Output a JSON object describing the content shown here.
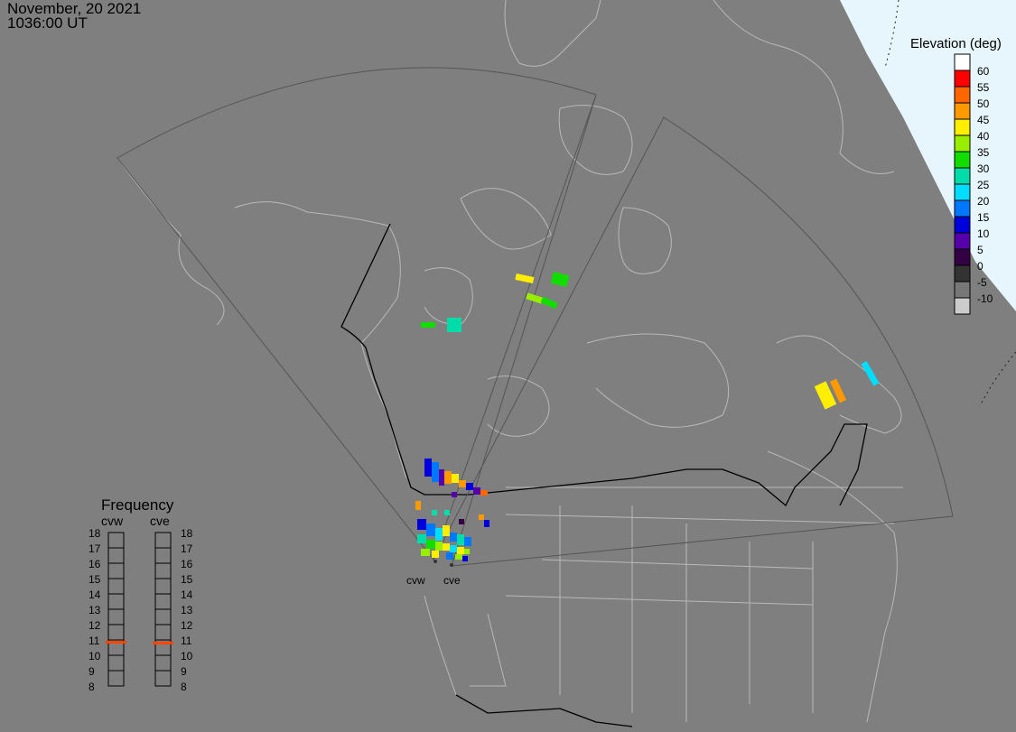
{
  "header": {
    "date": "November, 20 2021",
    "time": "1036:00 UT"
  },
  "legend": {
    "title": "Elevation (deg)",
    "levels": [
      {
        "label": "60",
        "color": "#ff0000"
      },
      {
        "label": "55",
        "color": "#ff6600"
      },
      {
        "label": "50",
        "color": "#ff9900"
      },
      {
        "label": "45",
        "color": "#ffee00"
      },
      {
        "label": "40",
        "color": "#99ee00"
      },
      {
        "label": "35",
        "color": "#11dd00"
      },
      {
        "label": "30",
        "color": "#00ddaa"
      },
      {
        "label": "25",
        "color": "#00ddff"
      },
      {
        "label": "20",
        "color": "#0077ff"
      },
      {
        "label": "15",
        "color": "#0000dd"
      },
      {
        "label": "10",
        "color": "#5500aa"
      },
      {
        "label": "5",
        "color": "#330044"
      },
      {
        "label": "0",
        "color": "#333333"
      },
      {
        "label": "-5",
        "color": "#777777"
      },
      {
        "label": "-10",
        "color": "#cccccc"
      }
    ],
    "top_color": "#ffffff"
  },
  "frequency": {
    "title": "Frequency",
    "radars": [
      "cvw",
      "cve"
    ],
    "ticks": [
      "18",
      "17",
      "16",
      "15",
      "14",
      "13",
      "12",
      "11",
      "10",
      "9",
      "8"
    ],
    "markers": [
      10.85,
      10.8
    ],
    "marker_color": "#ff4400"
  },
  "sites": [
    "cvw",
    "cve"
  ]
}
